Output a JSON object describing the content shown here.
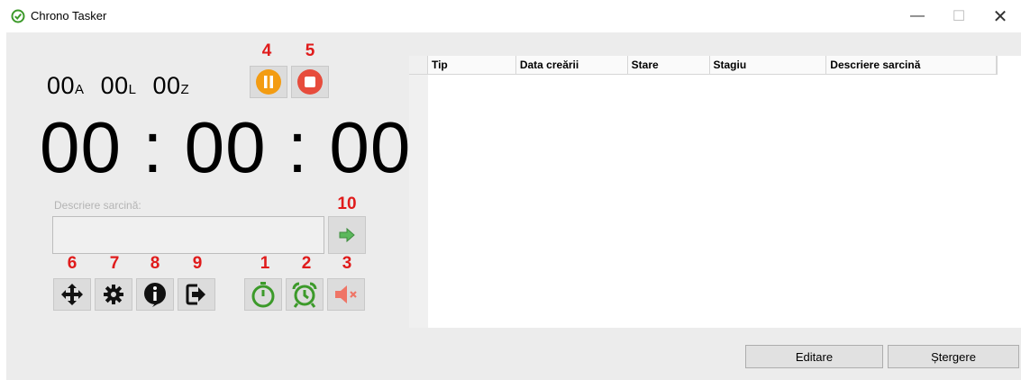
{
  "window": {
    "title": "Chrono Tasker"
  },
  "counters": [
    {
      "value": "00",
      "unit": "A"
    },
    {
      "value": "00",
      "unit": "L"
    },
    {
      "value": "00",
      "unit": "Z"
    }
  ],
  "timer": {
    "display": "00 : 00 : 00"
  },
  "annotations": {
    "n1": "1",
    "n2": "2",
    "n3": "3",
    "n4": "4",
    "n5": "5",
    "n6": "6",
    "n7": "7",
    "n8": "8",
    "n9": "9",
    "n10": "10"
  },
  "icons": {
    "pause": "pause-icon",
    "stop": "stop-icon",
    "submit": "arrow-right-icon",
    "move": "move-icon",
    "settings": "gear-icon",
    "info": "info-icon",
    "exit": "exit-icon",
    "stopwatch": "stopwatch-icon",
    "alarm": "alarm-clock-icon",
    "mute": "speaker-muted-icon"
  },
  "colors": {
    "accent_green": "#3c9a2a",
    "pause_orange": "#f39c12",
    "stop_red": "#e74c3c",
    "annotation_red": "#e01b1b"
  },
  "task_form": {
    "label": "Descriere sarcină:",
    "value": ""
  },
  "table": {
    "columns": [
      "Tip",
      "Data creării",
      "Stare",
      "Stagiu",
      "Descriere sarcină"
    ]
  },
  "buttons": {
    "edit": "Editare",
    "delete": "Ștergere"
  }
}
